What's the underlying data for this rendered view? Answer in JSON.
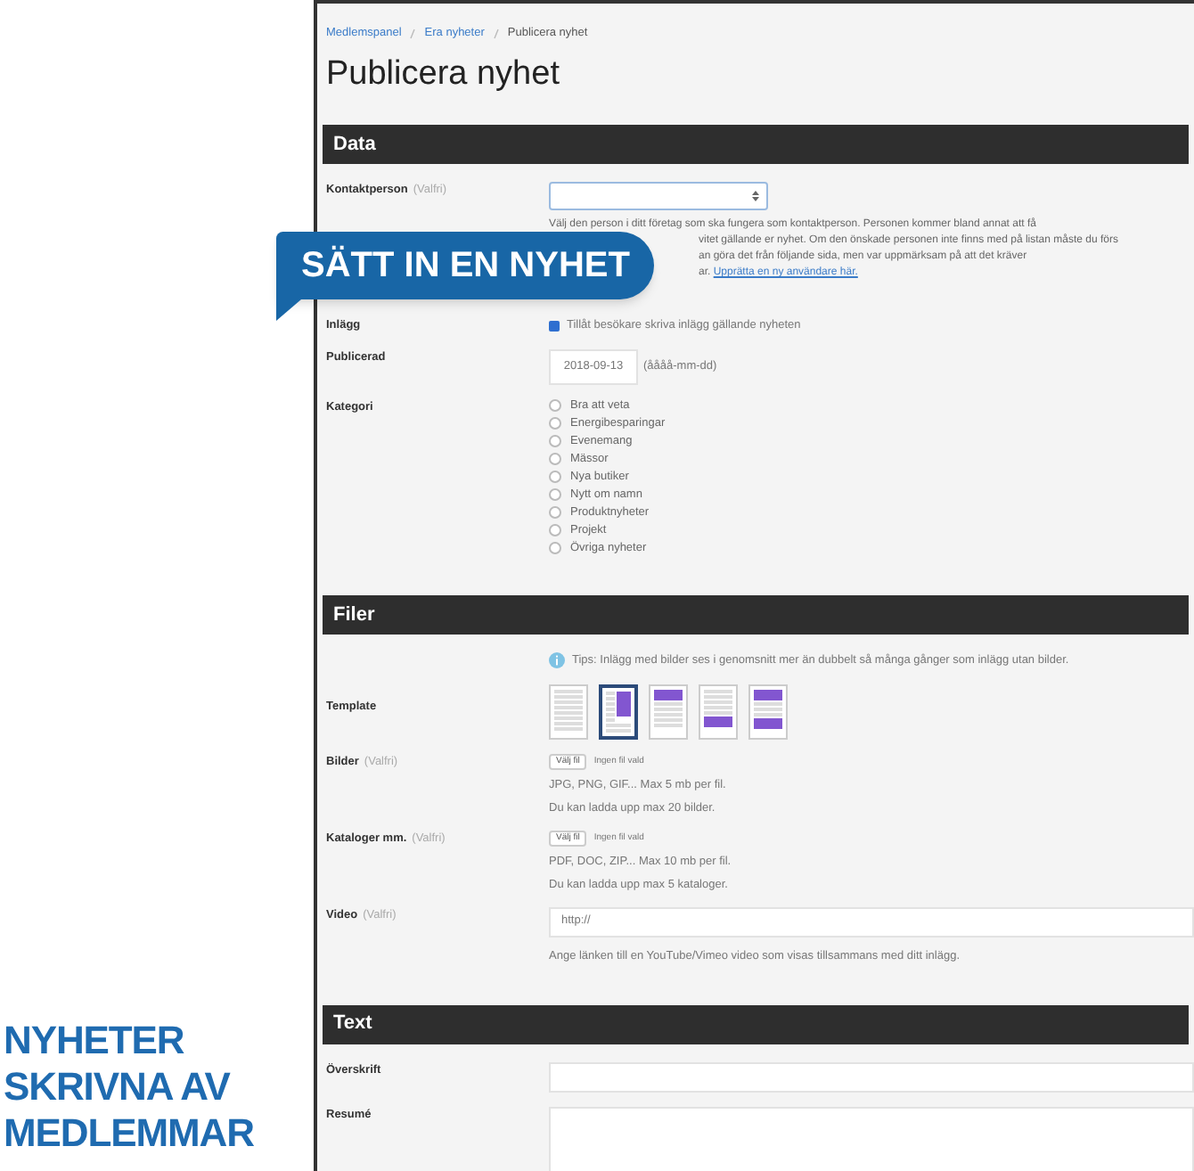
{
  "side_heading": [
    "NYHETER",
    "SKRIVNA AV",
    "MEDLEMMAR"
  ],
  "callout": "SÄTT IN EN NYHET",
  "breadcrumb": [
    "Medlemspanel",
    "Era nyheter",
    "Publicera nyhet"
  ],
  "title": "Publicera nyhet",
  "sections": [
    {
      "title": "Data",
      "fields": [
        {
          "kind": "select",
          "label": "Kontaktperson",
          "optional": "(Valfri)",
          "help_lines": [
            "Välj den person i ditt företag som ska fungera som kontaktperson. Personen kommer bland annat att få",
            "vitet gällande er nyhet. Om den önskade personen inte finns med på listan måste du förs",
            "an göra det från följande sida, men var uppmärksam på att det kräver",
            "ar."
          ],
          "help_link": "Upprätta en ny användare här."
        },
        {
          "kind": "checkbox",
          "label": "Inlägg",
          "text": "Tillåt besökare skriva inlägg gällande nyheten",
          "checked": true
        },
        {
          "kind": "date",
          "label": "Publicerad",
          "value": "2018-09-13",
          "format": "(åååå-mm-dd)"
        },
        {
          "kind": "radio",
          "label": "Kategori",
          "options": [
            {
              "label": "Bra att veta",
              "selected": false
            },
            {
              "label": "Energibesparingar",
              "selected": false
            },
            {
              "label": "Evenemang",
              "selected": false
            },
            {
              "label": "Mässor",
              "selected": false
            },
            {
              "label": "Nya butiker",
              "selected": false
            },
            {
              "label": "Nytt om namn",
              "selected": false
            },
            {
              "label": "Produktnyheter",
              "selected": false
            },
            {
              "label": "Projekt",
              "selected": false
            },
            {
              "label": "Övriga nyheter",
              "selected": false
            }
          ]
        }
      ]
    },
    {
      "title": "Filer",
      "fields": [
        {
          "kind": "info",
          "text": "Tips: Inlägg med bilder ses i genomsnitt mer än dubbelt så många gånger som inlägg utan bilder."
        },
        {
          "kind": "templates",
          "label": "Template",
          "options": [
            {
              "kind": "text",
              "selected": false
            },
            {
              "kind": "side",
              "selected": true
            },
            {
              "kind": "top",
              "selected": false
            },
            {
              "kind": "bottom",
              "selected": false
            },
            {
              "kind": "top_bottom",
              "selected": false
            }
          ]
        },
        {
          "kind": "file",
          "label": "Bilder",
          "optional": "(Valfri)",
          "button": "Välj fil",
          "status": "Ingen fil vald",
          "notes": [
            "JPG, PNG, GIF... Max 5 mb per fil.",
            "Du kan ladda upp max 20 bilder."
          ]
        },
        {
          "kind": "file",
          "label": "Kataloger mm.",
          "optional": "(Valfri)",
          "button": "Välj fil",
          "status": "Ingen fil vald",
          "notes": [
            "PDF, DOC, ZIP... Max 10 mb per fil.",
            "Du kan ladda upp max 5 kataloger."
          ]
        },
        {
          "kind": "url",
          "label": "Video",
          "optional": "(Valfri)",
          "value": "http://",
          "help": "Ange länken till en YouTube/Vimeo video som visas tillsammans med ditt inlägg."
        }
      ]
    },
    {
      "title": "Text",
      "fields": [
        {
          "kind": "text",
          "label": "Överskrift"
        },
        {
          "kind": "textarea",
          "label": "Resumé"
        }
      ]
    }
  ]
}
